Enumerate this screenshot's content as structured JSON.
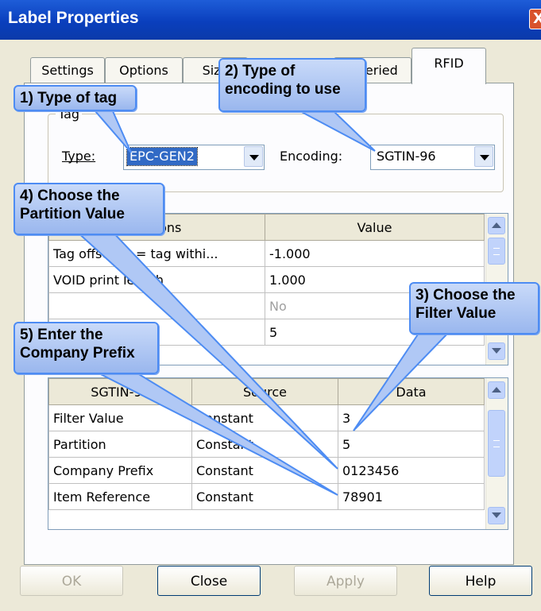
{
  "window": {
    "title": "Label Properties",
    "close_glyph": "X"
  },
  "tabs": [
    "Settings",
    "Options",
    "Size",
    "Queried",
    "RFID"
  ],
  "tag_group": {
    "legend": "Tag",
    "type_label": "Type:",
    "type_value": "EPC-GEN2",
    "encoding_label": "Encoding:",
    "encoding_value": "SGTIN-96"
  },
  "options_grid": {
    "headers": [
      "Options",
      "Value"
    ],
    "rows": [
      {
        "option": "Tag offset (0 = tag withi...",
        "value": "-1.000"
      },
      {
        "option": "VOID print length",
        "value": "1.000"
      },
      {
        "option": "",
        "value": "No"
      },
      {
        "option": "",
        "value": "5"
      }
    ]
  },
  "encoding_grid": {
    "headers": [
      "SGTIN-96",
      "Source",
      "Data"
    ],
    "rows": [
      {
        "field": "Filter Value",
        "source": "Constant",
        "data": "3"
      },
      {
        "field": "Partition",
        "source": "Constant",
        "data": "5"
      },
      {
        "field": "Company Prefix",
        "source": "Constant",
        "data": "0123456"
      },
      {
        "field": "Item Reference",
        "source": "Constant",
        "data": "78901"
      }
    ]
  },
  "buttons": {
    "ok": "OK",
    "close": "Close",
    "apply": "Apply",
    "help": "Help"
  },
  "callouts": {
    "c1": "1) Type of tag",
    "c2_line1": "2) Type of",
    "c2_line2": "encoding to use",
    "c3_line1": "3) Choose the",
    "c3_line2": "Filter Value",
    "c4_line1": "4) Choose the",
    "c4_line2": "Partition Value",
    "c5_line1": "5) Enter the",
    "c5_line2": "Company Prefix"
  },
  "colors": {
    "titlebar": "#0a3fbd",
    "callout_border": "#4d8cf3",
    "callout_fill": "#b0c8f5",
    "selection": "#316ac5"
  }
}
